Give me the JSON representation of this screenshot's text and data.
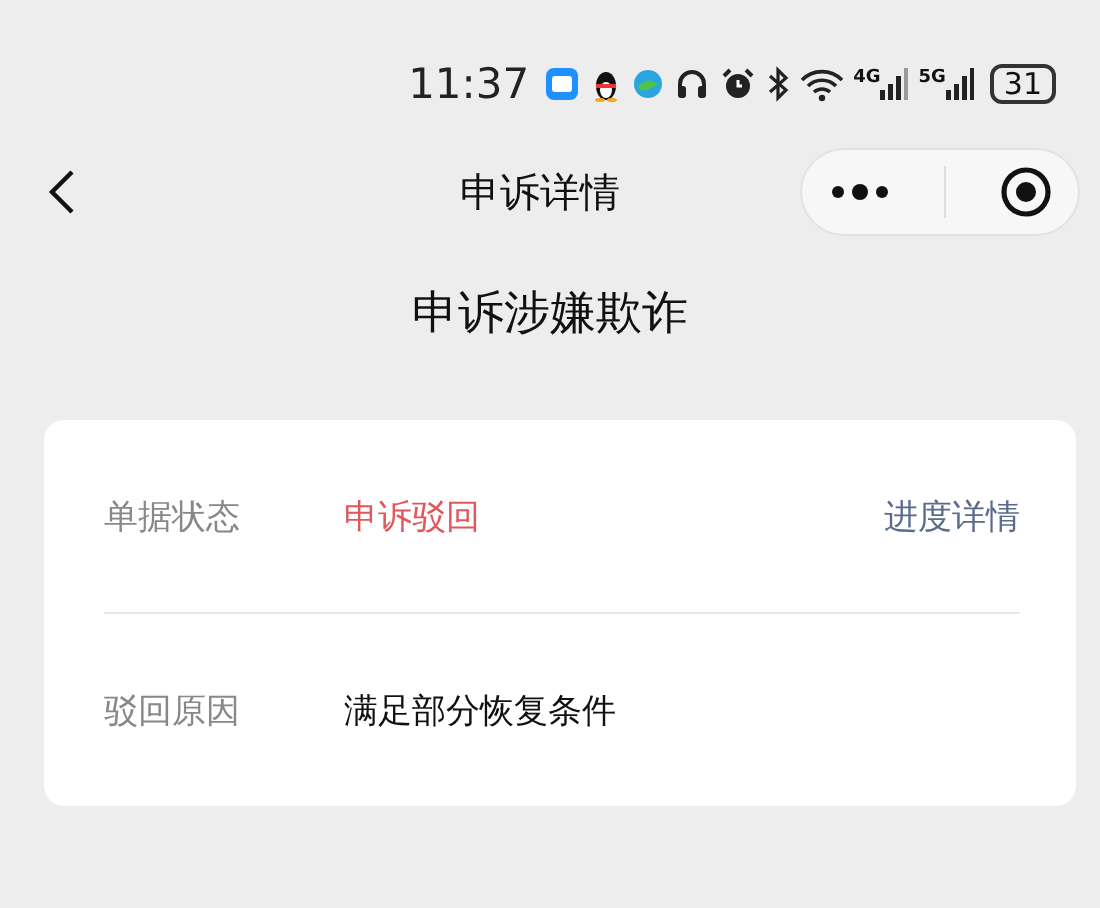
{
  "status_bar": {
    "time": "11:37",
    "signal_4g": "4G",
    "signal_5g": "5G",
    "battery": "31"
  },
  "nav_bar": {
    "title": "申诉详情"
  },
  "heading": "申诉涉嫌欺诈",
  "details": [
    {
      "label": "单据状态",
      "value": "申诉驳回",
      "color": "#e0585b",
      "link": "进度详情"
    },
    {
      "label": "驳回原因",
      "value": "满足部分恢复条件"
    }
  ]
}
